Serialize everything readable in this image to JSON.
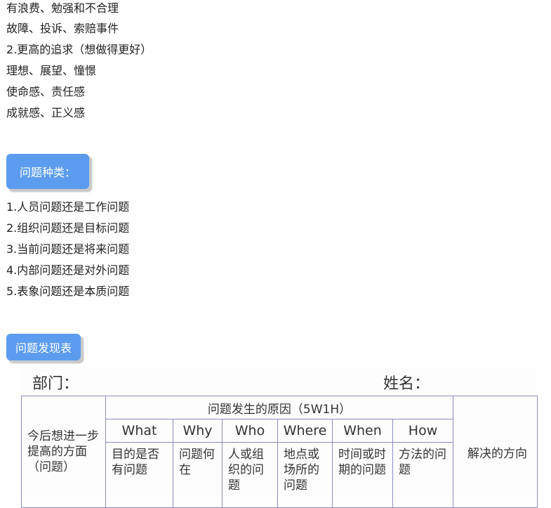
{
  "lines_top": [
    "有浪费、勉强和不合理",
    "故障、投诉、索赔事件",
    "2.更高的追求（想做得更好）",
    "理想、展望、憧憬",
    "使命感、责任感",
    "成就感、正义感"
  ],
  "section1": {
    "badge": "问题种类：",
    "items": [
      "1.人员问题还是工作问题",
      "2.组织问题还是目标问题",
      "3.当前问题还是将来问题",
      "4.内部问题还是对外问题",
      "5.表象问题还是本质问题"
    ]
  },
  "section2": {
    "badge": "问题发现表",
    "form": {
      "dept_label": "部门：",
      "name_label": "姓名：",
      "first_col": "今后想进一步提高的方面（问题）",
      "cause_header": "问题发生的原因（5W1H）",
      "columns": [
        {
          "w": "What",
          "desc": "目的是否有问题"
        },
        {
          "w": "Why",
          "desc": "问题何在"
        },
        {
          "w": "Who",
          "desc": "人或组织的问题"
        },
        {
          "w": "Where",
          "desc": "地点或场所的问题"
        },
        {
          "w": "When",
          "desc": "时间或时期的问题"
        },
        {
          "w": "How",
          "desc": "方法的问题"
        }
      ],
      "last_col": "解决的方向"
    }
  },
  "colors": {
    "badge_bg": "#5b9cef",
    "table_border": "#8c8cbf"
  }
}
